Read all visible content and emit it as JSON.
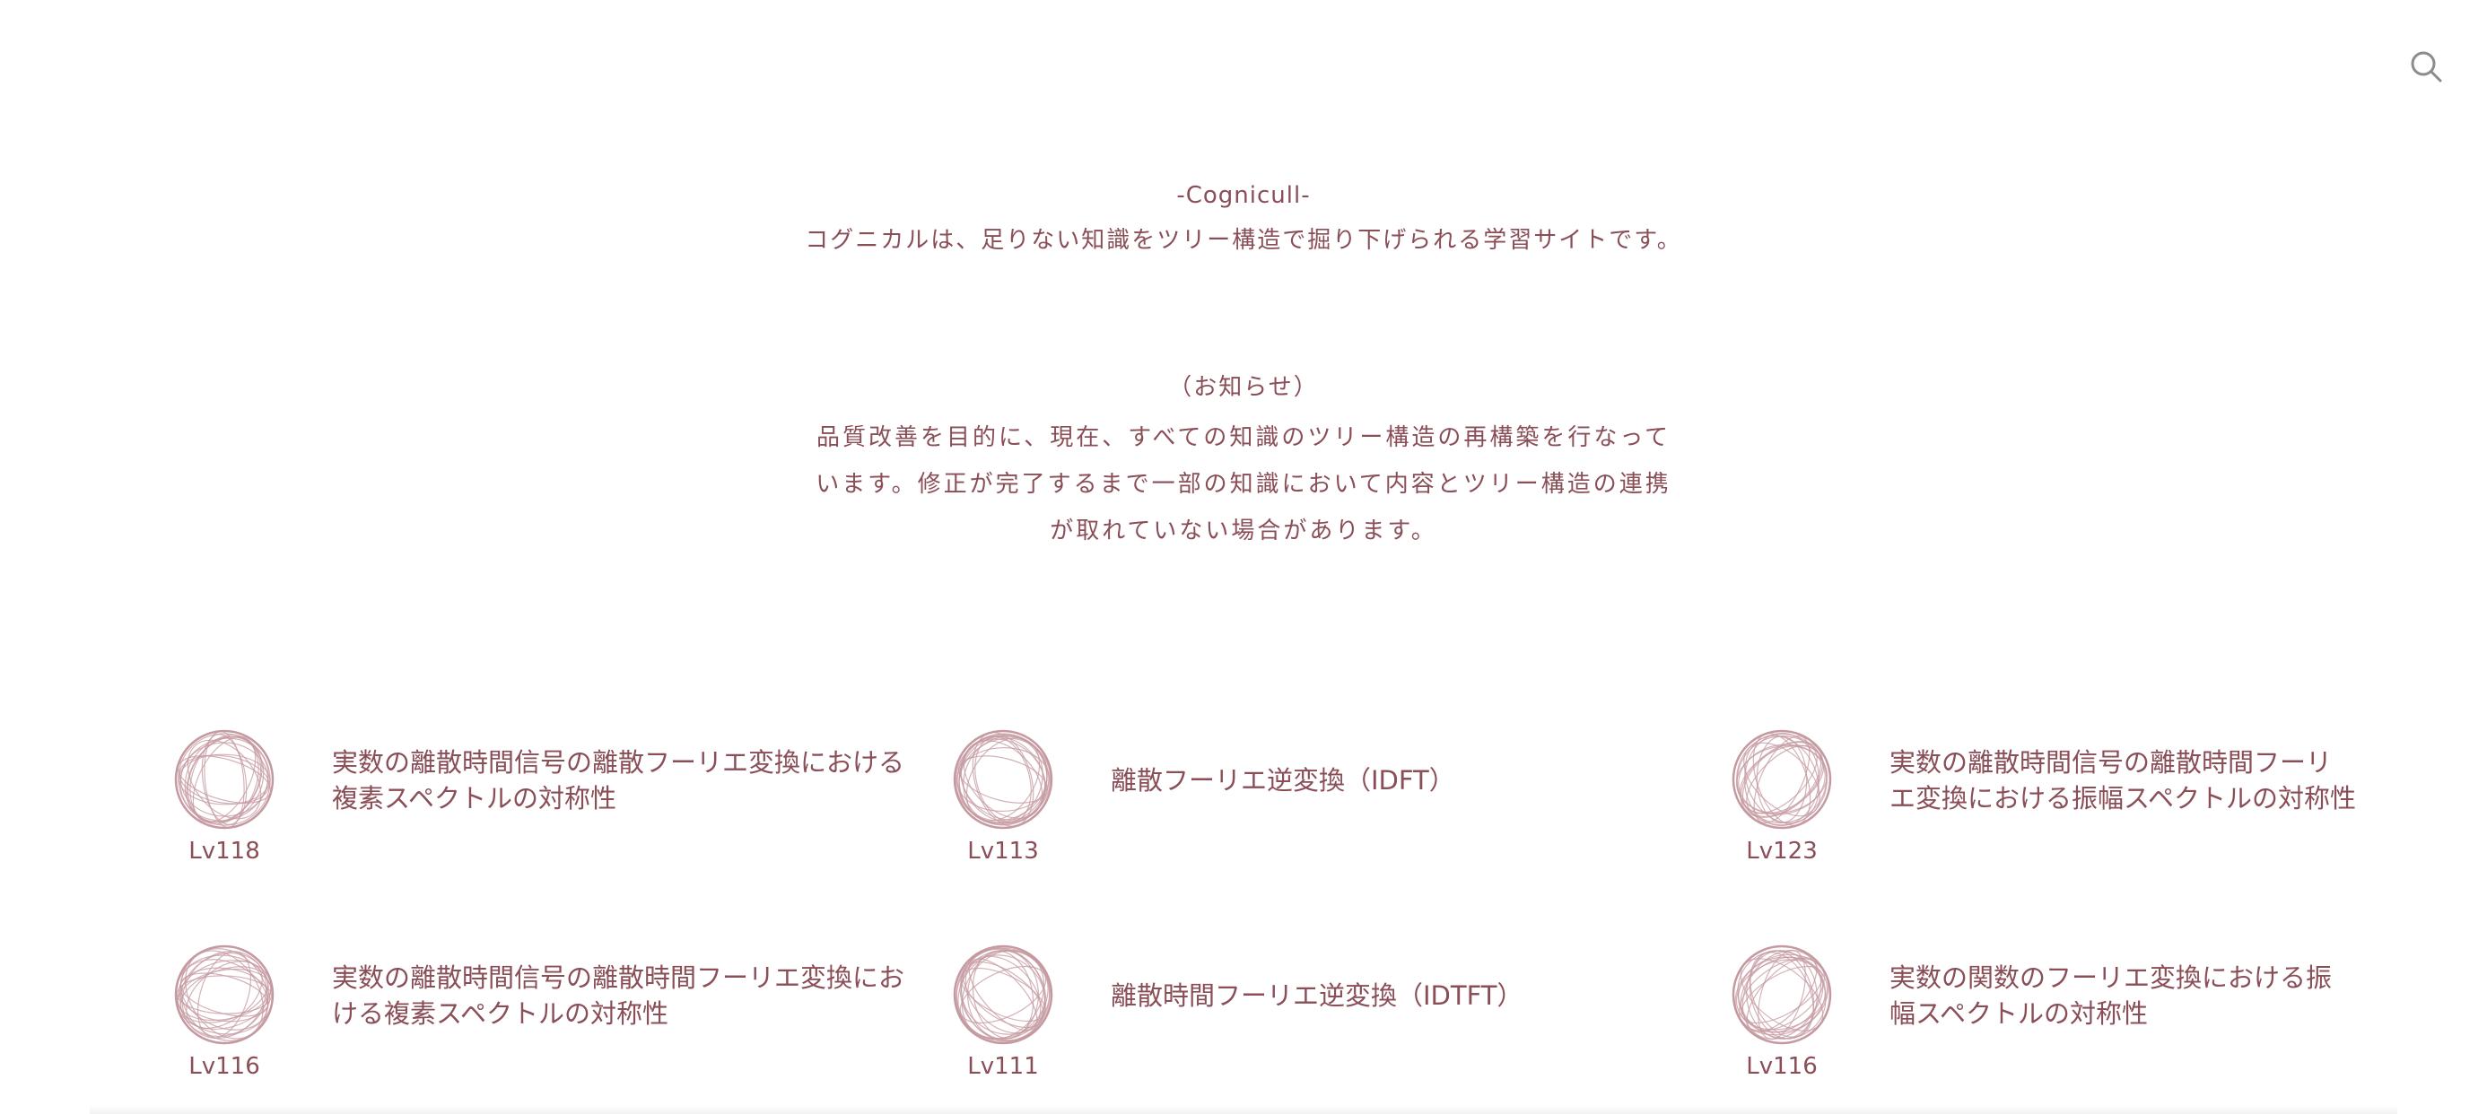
{
  "header": {
    "search_icon": "search-icon"
  },
  "intro": {
    "brand": "-Cognicull-",
    "tagline": "コグニカルは、足りない知識をツリー構造で掘り下げられる学習サイトです。"
  },
  "notice": {
    "title": "（お知らせ）",
    "body": "品質改善を目的に、現在、すべての知識のツリー構造の再構築を行なっています。修正が完了するまで一部の知識において内容とツリー構造の連携が取れていない場合があります。"
  },
  "cards": [
    {
      "level": "Lv118",
      "title": "実数の離散時間信号の離散フーリエ変換における複素スペクトルの対称性"
    },
    {
      "level": "Lv113",
      "title": "離散フーリエ逆変換（IDFT）"
    },
    {
      "level": "Lv123",
      "title": "実数の離散時間信号の離散時間フーリエ変換における振幅スペクトルの対称性"
    },
    {
      "level": "Lv116",
      "title": "実数の離散時間信号の離散時間フーリエ変換における複素スペクトルの対称性"
    },
    {
      "level": "Lv111",
      "title": "離散時間フーリエ逆変換（IDTFT）"
    },
    {
      "level": "Lv116",
      "title": "実数の関数のフーリエ変換における振幅スペクトルの対称性"
    }
  ],
  "colors": {
    "text": "#8a4e57",
    "ball_stroke": "#c49aa0"
  }
}
